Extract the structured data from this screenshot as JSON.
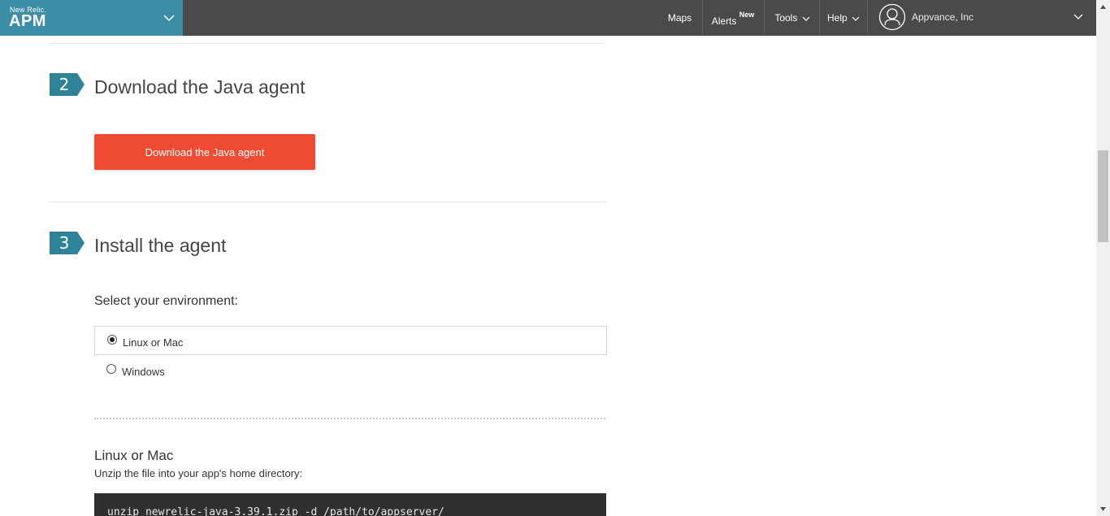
{
  "topbar": {
    "brand_small": "New Relic.",
    "brand_big": "APM",
    "nav": {
      "maps": "Maps",
      "alerts": "Alerts",
      "alerts_badge": "New",
      "tools": "Tools",
      "help": "Help"
    },
    "org_name": "Appvance, Inc"
  },
  "steps": {
    "download": {
      "number": "2",
      "title": "Download the Java agent",
      "button_label": "Download the Java agent"
    },
    "install": {
      "number": "3",
      "title": "Install the agent",
      "env_label": "Select your environment:",
      "options": [
        {
          "label": "Linux or Mac",
          "selected": true
        },
        {
          "label": "Windows",
          "selected": false
        }
      ],
      "section_title": "Linux or Mac",
      "section_desc": "Unzip the file into your app's home directory:",
      "command": "unzip newrelic-java-3.39.1.zip -d /path/to/appserver/"
    }
  },
  "colors": {
    "topbar_bg": "#4a4a4a",
    "brand_bg": "#3b8ea5",
    "step_badge": "#2f8399",
    "button_bg": "#ef4b32",
    "code_bg": "#2f3031"
  }
}
